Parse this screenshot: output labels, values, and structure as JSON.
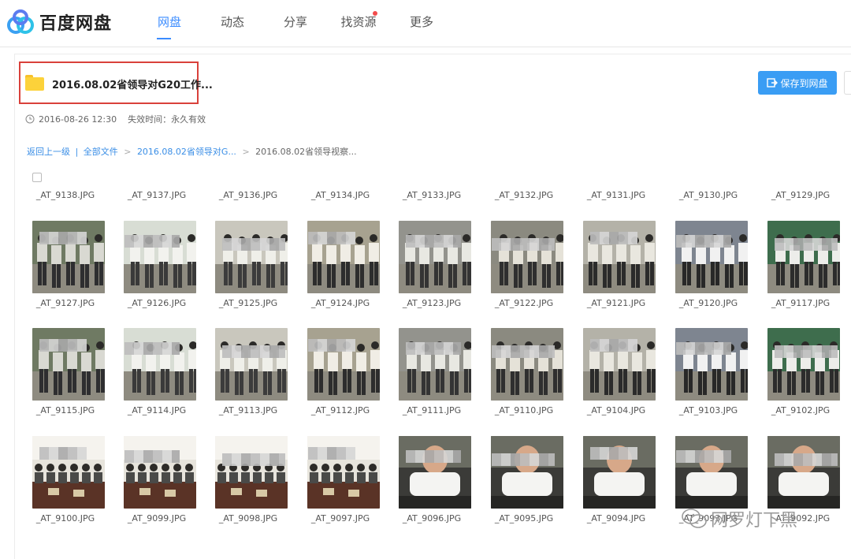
{
  "app": {
    "logo_text": "百度网盘"
  },
  "nav": [
    {
      "label": "网盘",
      "active": true
    },
    {
      "label": "动态",
      "active": false
    },
    {
      "label": "分享",
      "active": false
    },
    {
      "label": "找资源",
      "active": false,
      "has_dot": true
    },
    {
      "label": "更多",
      "active": false
    }
  ],
  "folder": {
    "name": "2016.08.02省领导对G20工作...",
    "date": "2016-08-26 12:30",
    "expire": "失效时间：永久有效"
  },
  "toolbar": {
    "save_label": "保存到网盘"
  },
  "breadcrumb": {
    "back": "返回上一级",
    "divider": "|",
    "all": "全部文件",
    "parent": "2016.08.02省领导对G...",
    "current": "2016.08.02省领导视察..."
  },
  "top_labels": [
    "_AT_9138.JPG",
    "_AT_9137.JPG",
    "_AT_9136.JPG",
    "_AT_9134.JPG",
    "_AT_9133.JPG",
    "_AT_9132.JPG",
    "_AT_9131.JPG",
    "_AT_9130.JPG",
    "_AT_9129.JPG"
  ],
  "rows": [
    [
      "_AT_9127.JPG",
      "_AT_9126.JPG",
      "_AT_9125.JPG",
      "_AT_9124.JPG",
      "_AT_9123.JPG",
      "_AT_9122.JPG",
      "_AT_9121.JPG",
      "_AT_9120.JPG",
      "_AT_9117.JPG"
    ],
    [
      "_AT_9115.JPG",
      "_AT_9114.JPG",
      "_AT_9113.JPG",
      "_AT_9112.JPG",
      "_AT_9111.JPG",
      "_AT_9110.JPG",
      "_AT_9104.JPG",
      "_AT_9103.JPG",
      "_AT_9102.JPG"
    ],
    [
      "_AT_9100.JPG",
      "_AT_9099.JPG",
      "_AT_9098.JPG",
      "_AT_9097.JPG",
      "_AT_9096.JPG",
      "_AT_9095.JPG",
      "_AT_9094.JPG",
      "_AT_9093.JPG",
      "_AT_9092.JPG"
    ]
  ],
  "watermark": {
    "text": "网罗灯下黑"
  },
  "colors": {
    "accent": "#3b8cff",
    "highlight_box": "#d9413b",
    "folder": "#fcd23a"
  }
}
